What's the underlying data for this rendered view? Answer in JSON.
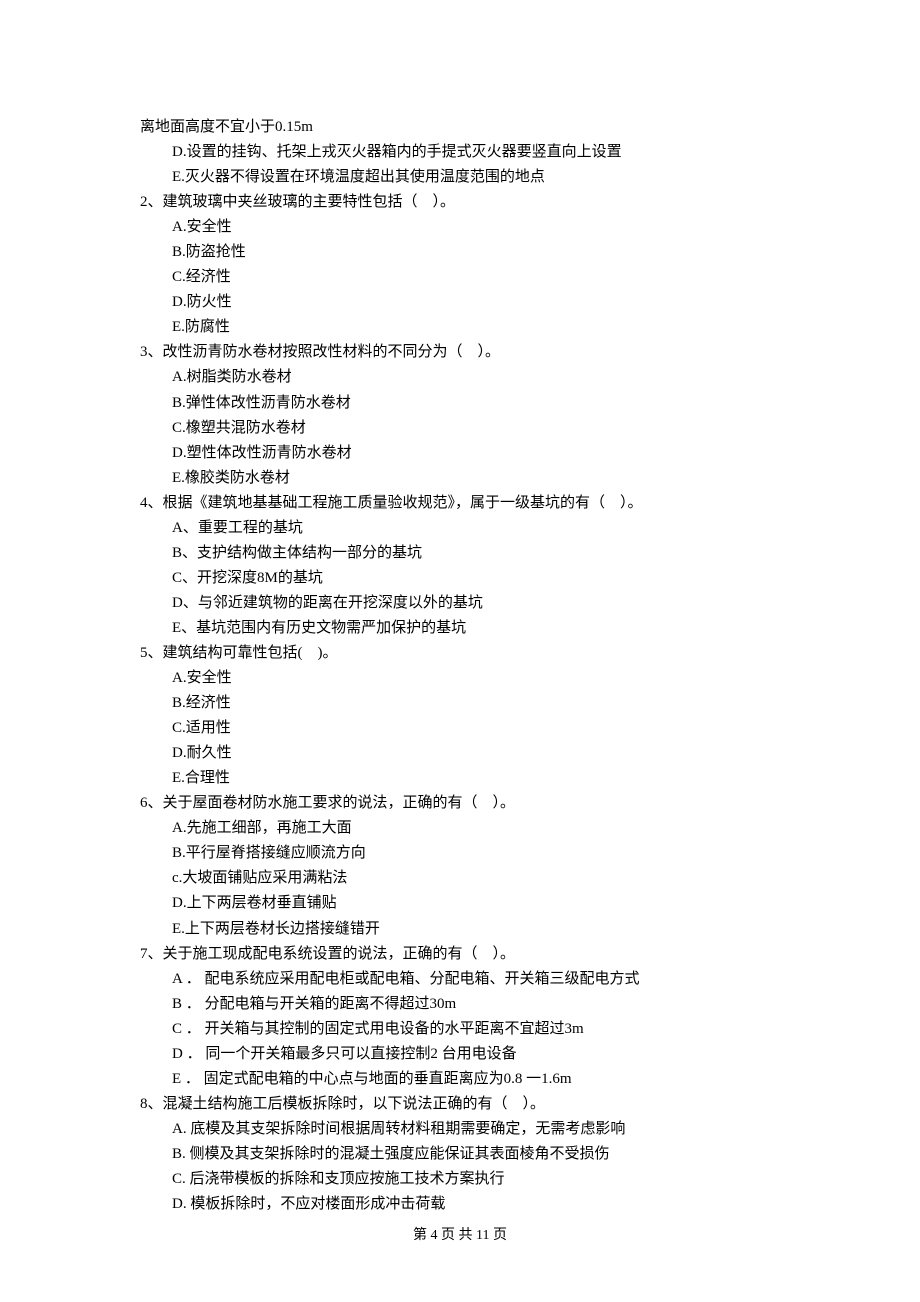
{
  "lines": [
    {
      "cls": "indent-0",
      "text": "离地面高度不宜小于0.15m"
    },
    {
      "cls": "indent-1",
      "text": "D.设置的挂钩、托架上戎灭火器箱内的手提式灭火器要竖直向上设置"
    },
    {
      "cls": "indent-1",
      "text": "E.灭火器不得设置在环境温度超出其使用温度范围的地点"
    },
    {
      "cls": "indent-0",
      "text": "2、建筑玻璃中夹丝玻璃的主要特性包括（    ）。"
    },
    {
      "cls": "indent-1",
      "text": "A.安全性"
    },
    {
      "cls": "indent-1",
      "text": "B.防盗抢性"
    },
    {
      "cls": "indent-1",
      "text": "C.经济性"
    },
    {
      "cls": "indent-1",
      "text": "D.防火性"
    },
    {
      "cls": "indent-1",
      "text": "E.防腐性"
    },
    {
      "cls": "indent-0",
      "text": "3、改性沥青防水卷材按照改性材料的不同分为（    ）。"
    },
    {
      "cls": "indent-1",
      "text": "A.树脂类防水卷材"
    },
    {
      "cls": "indent-1",
      "text": "B.弹性体改性沥青防水卷材"
    },
    {
      "cls": "indent-1",
      "text": "C.橡塑共混防水卷材"
    },
    {
      "cls": "indent-1",
      "text": "D.塑性体改性沥青防水卷材"
    },
    {
      "cls": "indent-1",
      "text": "E.橡胶类防水卷材"
    },
    {
      "cls": "indent-0",
      "text": "4、根据《建筑地基基础工程施工质量验收规范》，属于一级基坑的有（    ）。"
    },
    {
      "cls": "indent-1",
      "text": "A、重要工程的基坑"
    },
    {
      "cls": "indent-1",
      "text": "B、支护结构做主体结构一部分的基坑"
    },
    {
      "cls": "indent-1",
      "text": "C、开挖深度8M的基坑"
    },
    {
      "cls": "indent-1",
      "text": "D、与邻近建筑物的距离在开挖深度以外的基坑"
    },
    {
      "cls": "indent-1",
      "text": "E、基坑范围内有历史文物需严加保护的基坑"
    },
    {
      "cls": "indent-0",
      "text": "5、建筑结构可靠性包括(    )。"
    },
    {
      "cls": "indent-1",
      "text": "A.安全性"
    },
    {
      "cls": "indent-1",
      "text": "B.经济性"
    },
    {
      "cls": "indent-1",
      "text": "C.适用性"
    },
    {
      "cls": "indent-1",
      "text": "D.耐久性"
    },
    {
      "cls": "indent-1",
      "text": "E.合理性"
    },
    {
      "cls": "indent-0",
      "text": "6、关于屋面卷材防水施工要求的说法，正确的有（    ）。"
    },
    {
      "cls": "indent-1",
      "text": "A.先施工细部，再施工大面"
    },
    {
      "cls": "indent-1",
      "text": "B.平行屋脊搭接缝应顺流方向"
    },
    {
      "cls": "indent-1",
      "text": "c.大坡面铺贴应采用满粘法"
    },
    {
      "cls": "indent-1",
      "text": "D.上下两层卷材垂直铺贴"
    },
    {
      "cls": "indent-1",
      "text": "E.上下两层卷材长边搭接缝错开"
    },
    {
      "cls": "indent-0",
      "text": "7、关于施工现成配电系统设置的说法，正确的有（    ）。"
    },
    {
      "cls": "indent-1",
      "text": "A ． 配电系统应采用配电柜或配电箱、分配电箱、开关箱三级配电方式"
    },
    {
      "cls": "indent-1",
      "text": "B ． 分配电箱与开关箱的距离不得超过30m"
    },
    {
      "cls": "indent-1",
      "text": "C ． 开关箱与其控制的固定式用电设备的水平距离不宜超过3m"
    },
    {
      "cls": "indent-1",
      "text": "D ． 同一个开关箱最多只可以直接控制2 台用电设备"
    },
    {
      "cls": "indent-1",
      "text": "E ． 固定式配电箱的中心点与地面的垂直距离应为0.8 一1.6m"
    },
    {
      "cls": "indent-0",
      "text": "8、混凝土结构施工后模板拆除时，以下说法正确的有（    ）。"
    },
    {
      "cls": "indent-1",
      "text": "A. 底模及其支架拆除时间根据周转材料租期需要确定，无需考虑影响"
    },
    {
      "cls": "indent-1",
      "text": "B. 侧模及其支架拆除时的混凝土强度应能保证其表面棱角不受损伤"
    },
    {
      "cls": "indent-1",
      "text": "C. 后浇带模板的拆除和支顶应按施工技术方案执行"
    },
    {
      "cls": "indent-1",
      "text": "D. 模板拆除时，不应对楼面形成冲击荷载"
    }
  ],
  "footer": "第 4 页 共 11 页"
}
